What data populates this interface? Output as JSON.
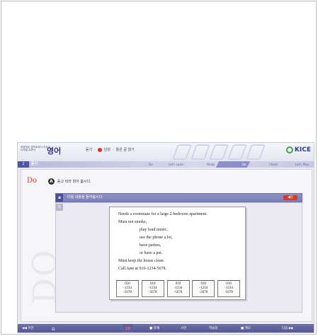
{
  "header": {
    "brand_small": [
      "초등학교 영어교과서 지도서",
      "디지털 교과서"
    ],
    "brand_big": "영어",
    "breadcrumb": [
      "듣기",
      "단원",
      "들은 글 읽기"
    ],
    "logo": "KICE"
  },
  "stepbar": {
    "level": "2",
    "level_label": "듣기",
    "steps": [
      "Do",
      "Let's Learn",
      "Study",
      "Do",
      "Check",
      "Let's Play"
    ]
  },
  "main": {
    "section_title": "Do",
    "watermark": "DO",
    "instruction": {
      "badge": "A",
      "text": "듣고 따라 읽어 봅시다."
    },
    "question_bar": {
      "number": "a",
      "text": "다음 내용을 들어봅시다.",
      "sound": "◀))"
    },
    "second_number": "b",
    "card_lines": [
      "Needs a roommate for a large 2-bedroom apartment.",
      "Must not smoke,",
      "play loud music,",
      "use the phone a lot,",
      "have parties,",
      "or have a pet.",
      "Must keep the house clean.",
      "Call Jane at 010-1234-5678."
    ],
    "tear_tabs": [
      [
        "010",
        "-1234",
        "-5678"
      ],
      [
        "010",
        "-1234",
        "-5678"
      ],
      [
        "010",
        "-1234",
        "-5678"
      ],
      [
        "010",
        "-1234",
        "-5678"
      ],
      [
        "010",
        "-1234",
        "-5678"
      ]
    ]
  },
  "footer": {
    "prev": "◀◀ 이전",
    "home": "⌂",
    "page": "19",
    "toc": "■ 차례",
    "dict": "사전",
    "notes": "학습장",
    "note": "■ 메모",
    "next": "다음 ▶▶"
  }
}
